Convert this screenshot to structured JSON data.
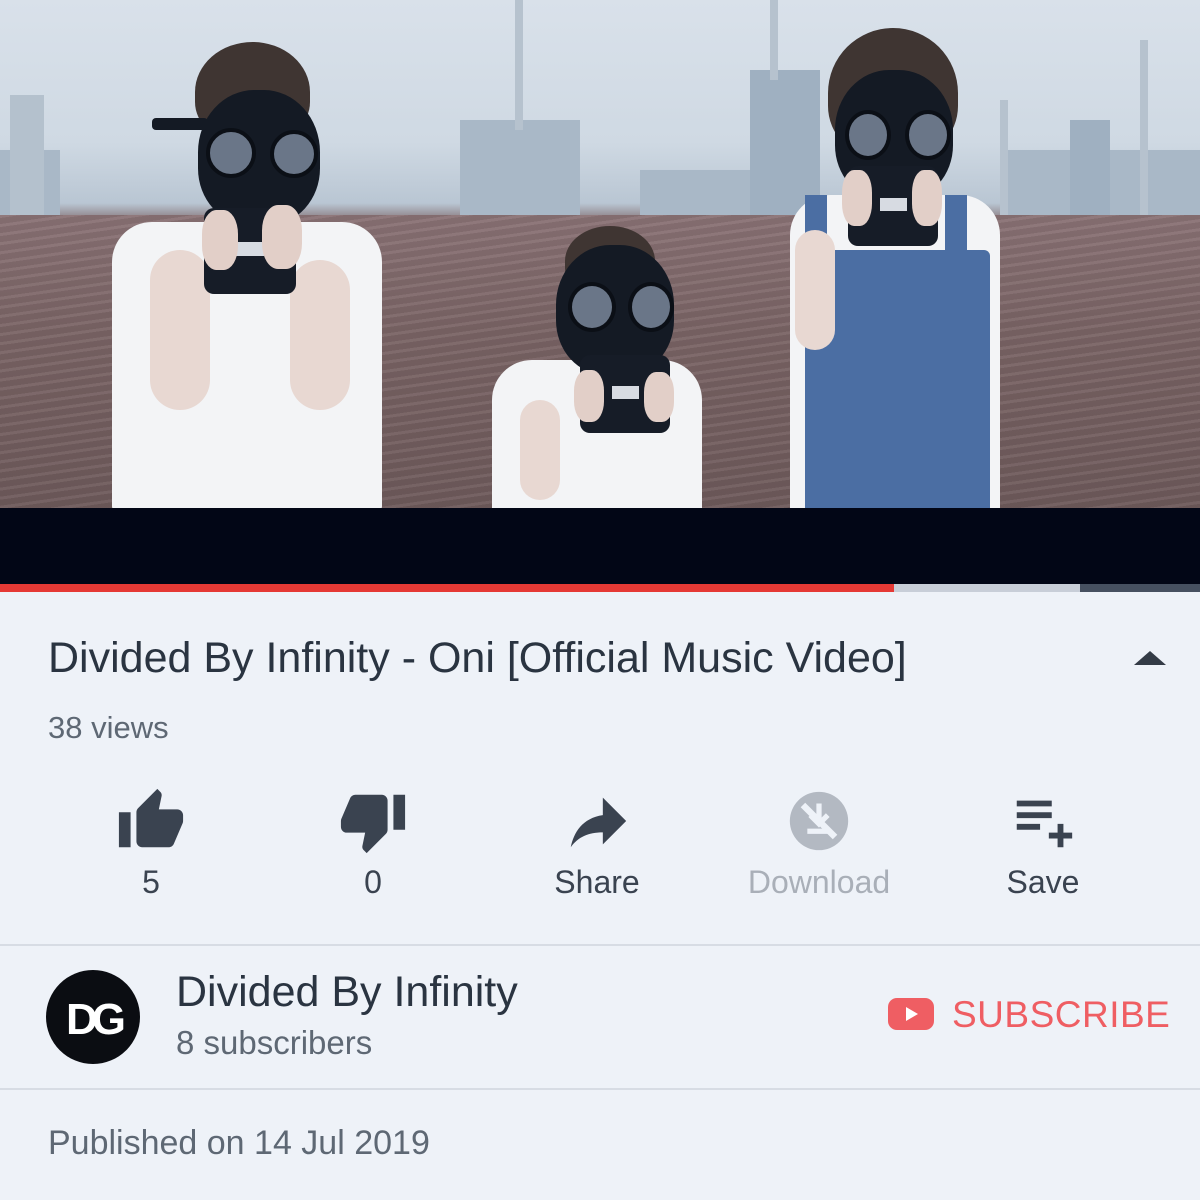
{
  "video": {
    "progress_played_fraction": 0.745,
    "colors": {
      "played": "#e53935",
      "buffered": "#c8ced8"
    }
  },
  "info": {
    "title": "Divided By Infinity - Oni [Official Music Video]",
    "views": "38 views",
    "collapse_icon": "chevron-up-icon"
  },
  "actions": [
    {
      "icon": "thumbs-up-icon",
      "label": "5",
      "disabled": false
    },
    {
      "icon": "thumbs-down-icon",
      "label": "0",
      "disabled": false
    },
    {
      "icon": "share-arrow-icon",
      "label": "Share",
      "disabled": false
    },
    {
      "icon": "download-disabled-icon",
      "label": "Download",
      "disabled": true
    },
    {
      "icon": "add-to-playlist-icon",
      "label": "Save",
      "disabled": false
    }
  ],
  "channel": {
    "avatar_text": "DG",
    "name": "Divided By Infinity",
    "subscribers": "8 subscribers",
    "subscribe_label": "SUBSCRIBE",
    "accent": "#ef5e63"
  },
  "published": "Published on 14 Jul 2019"
}
